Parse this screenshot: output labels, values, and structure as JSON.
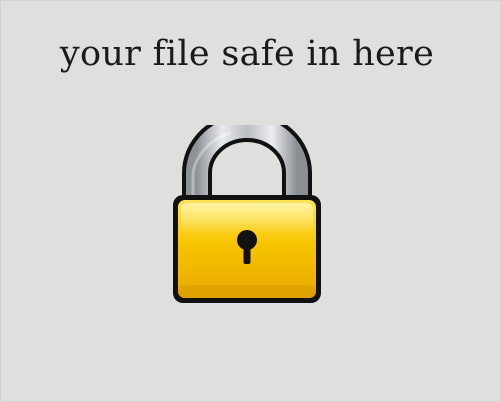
{
  "headline": "your file safe in here",
  "icon": "padlock-icon",
  "colors": {
    "background": "#dfdfdd",
    "text": "#1a1a1a",
    "lock_body": "#f7c300",
    "shackle": "#b0b5ba"
  }
}
